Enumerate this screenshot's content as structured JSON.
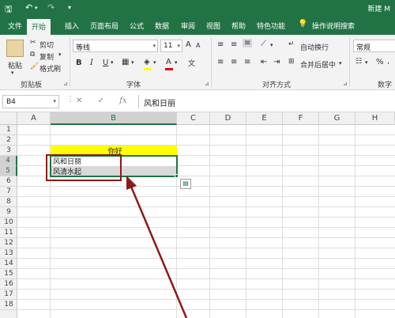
{
  "title": "新建 M",
  "quick_access": {
    "save": "🖫",
    "undo": "↶",
    "redo": "↷",
    "customize": "▾"
  },
  "tabs": [
    "文件",
    "开始",
    "插入",
    "页面布局",
    "公式",
    "数据",
    "审阅",
    "视图",
    "帮助",
    "特色功能"
  ],
  "active_tab": "开始",
  "tell_me": "操作说明搜索",
  "clipboard": {
    "paste": "粘贴",
    "cut": "剪切",
    "copy": "复制",
    "format_painter": "格式刷",
    "group": "剪贴板"
  },
  "font": {
    "name": "等线",
    "size": "11",
    "bold": "B",
    "italic": "I",
    "underline": "U",
    "grow": "A",
    "shrink": "A",
    "color_letter": "A",
    "group": "字体"
  },
  "alignment": {
    "wrap": "自动换行",
    "merge": "合并后居中",
    "group": "对齐方式"
  },
  "number": {
    "format": "常规",
    "percent": "%",
    "group": "数字"
  },
  "name_box": "B4",
  "formula": "风和日丽",
  "fx_icons": {
    "cancel": "✕",
    "confirm": "✓",
    "fx": "fx"
  },
  "columns": [
    "A",
    "B",
    "C",
    "D",
    "E",
    "F",
    "G",
    "H"
  ],
  "rows": [
    "1",
    "2",
    "3",
    "4",
    "5",
    "6",
    "7",
    "8",
    "9",
    "10",
    "11",
    "12",
    "13",
    "14",
    "15",
    "16",
    "17",
    "18"
  ],
  "cells": {
    "B3": "你好",
    "B4": "风和日丽",
    "B5": "风清水起"
  },
  "colors": {
    "excel_green": "#217346",
    "header_fill": "#ffff00",
    "annotation": "#8b1a1a",
    "selected_fill": "#d9d9d9"
  }
}
